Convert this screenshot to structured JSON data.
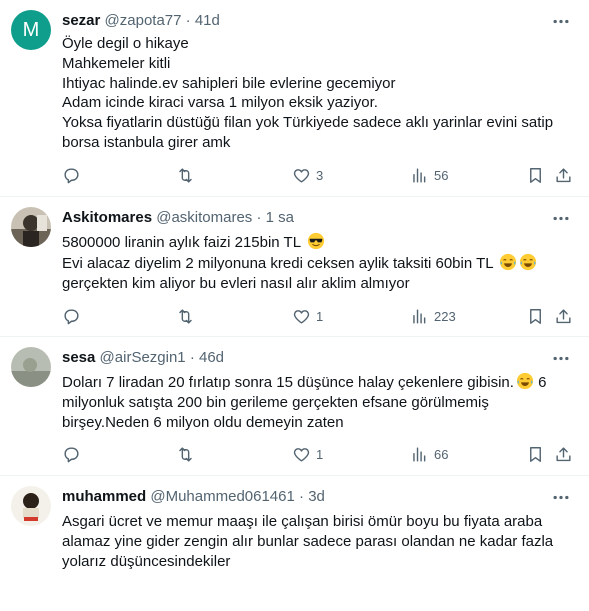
{
  "tweets": [
    {
      "name": "sezar",
      "handle": "@zapota77",
      "sep": "·",
      "time": "41d",
      "avatar_letter": "M",
      "lines": [
        "Öyle degil o hikaye",
        "Mahkemeler kitli",
        "Ihtiyac halinde.ev sahipleri bile evlerine gecemiyor",
        "Adam icinde kiraci varsa 1 milyon eksik yaziyor.",
        "Yoksa fiyatlarin düstüğü filan yok Türkiyede sadece aklı yarinlar evini satip",
        "borsa istanbula girer amk"
      ],
      "replies": "",
      "retweets": "",
      "likes": "3",
      "views": "56"
    },
    {
      "name": "Askitomares",
      "handle": "@askitomares",
      "sep": "·",
      "time": "1 sa",
      "lines": [
        "5800000 liranin aylık faizi 215bin TL",
        "Evi alacaz diyelim 2 milyonuna kredi ceksen aylik taksiti 60bin TL",
        "gerçekten kim aliyor bu evleri nasıl alır aklim almıyor"
      ],
      "replies": "",
      "retweets": "",
      "likes": "1",
      "views": "223"
    },
    {
      "name": "sesa",
      "handle": "@airSezgin1",
      "sep": "·",
      "time": "46d",
      "lines": [
        "Doları 7 liradan 20 fırlatıp sonra 15 düşünce halay çekenlere gibisin.",
        " 6",
        "milyonluk satışta 200 bin gerileme gerçekten efsane görülmemiş",
        "birşey.Neden 6 milyon oldu demeyin zaten"
      ],
      "replies": "",
      "retweets": "",
      "likes": "1",
      "views": "66"
    },
    {
      "name": "muhammed",
      "handle": "@Muhammed061461",
      "sep": "·",
      "time": "3d",
      "lines": [
        "Asgari ücret ve memur maaşı ile çalışan birisi ömür boyu bu fiyata araba",
        "alamaz yine gider zengin alır bunlar sadece parası olandan ne kadar fazla",
        "yolarız düşüncesindekiler"
      ]
    }
  ],
  "colors": {
    "text": "#0f1419",
    "muted": "#536471",
    "border": "#eff3f4",
    "avatar_m": "#0f9e8c"
  },
  "icons": [
    "more-icon",
    "reply-icon",
    "retweet-icon",
    "like-icon",
    "views-icon",
    "bookmark-icon",
    "share-icon",
    "sunglasses-emoji",
    "tears-of-joy-emoji"
  ]
}
